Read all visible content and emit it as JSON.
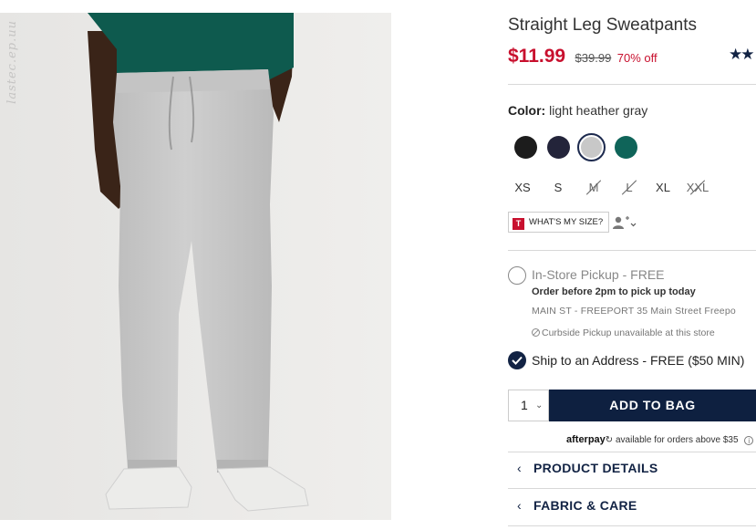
{
  "product": {
    "title": "Straight Leg Sweatpants",
    "price": "$11.99",
    "original_price": "$39.99",
    "discount": "70% off",
    "rating_stars": "★★"
  },
  "image": {
    "watermark": "lastec.ep.uu"
  },
  "color": {
    "label": "Color:",
    "selected_name": "light heather gray",
    "swatches": [
      {
        "name": "black",
        "hex": "#1c1c1c"
      },
      {
        "name": "navy",
        "hex": "#23243a"
      },
      {
        "name": "light heather gray",
        "hex": "#c8c8c8",
        "selected": true
      },
      {
        "name": "green",
        "hex": "#0f6459"
      }
    ]
  },
  "sizes": [
    {
      "label": "XS",
      "available": true
    },
    {
      "label": "S",
      "available": true
    },
    {
      "label": "M",
      "available": false
    },
    {
      "label": "L",
      "available": false
    },
    {
      "label": "XL",
      "available": true
    },
    {
      "label": "XXL",
      "available": false
    }
  ],
  "size_help": {
    "logo": "T",
    "label": "WHAT'S MY SIZE?"
  },
  "fulfillment": {
    "pickup_label": "In-Store Pickup - FREE",
    "pickup_note": "Order before 2pm to pick up today",
    "store": "MAIN ST - FREEPORT 35 Main Street  Freepo",
    "curbside": "Curbside Pickup unavailable at this store",
    "ship_label": "Ship to an Address - FREE ($50 MIN)"
  },
  "cart": {
    "quantity": "1",
    "add_label": "ADD TO BAG"
  },
  "afterpay": {
    "brand": "afterpay",
    "text": "available for orders above $35",
    "info": "i"
  },
  "accordions": [
    "PRODUCT DETAILS",
    "FABRIC & CARE"
  ],
  "colors": {
    "sale_red": "#c8102e",
    "navy": "#0e2040"
  }
}
